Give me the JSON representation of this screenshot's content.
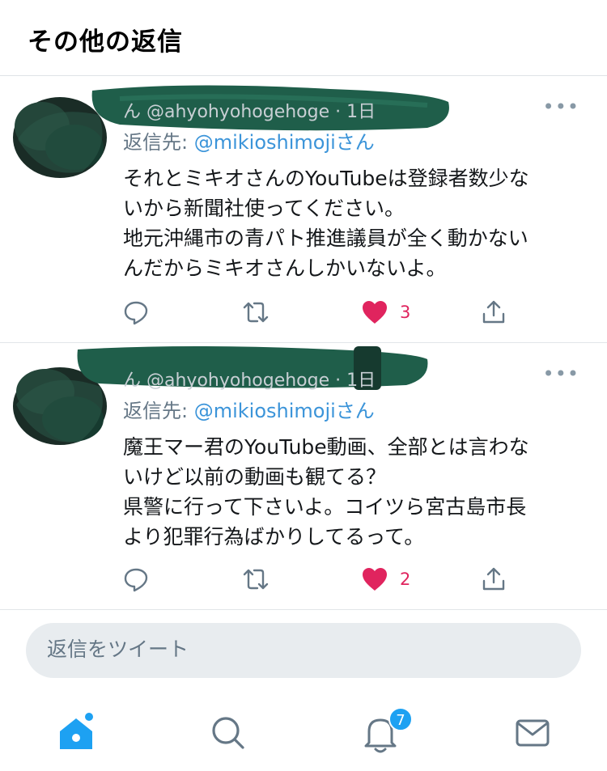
{
  "header": {
    "title": "その他の返信"
  },
  "tweets": [
    {
      "handle_line": "ん @ahyohyohogehoge · 1日",
      "reply_prefix": "返信先: ",
      "reply_mention": "@mikioshimoji",
      "reply_suffix": "さん",
      "body": [
        "それとミキオさんのYouTubeは登録者数少な",
        "いから新聞社使ってください。",
        "地元沖縄市の青パト推進議員が全く動かない",
        "んだからミキオさんしかいないよ。"
      ],
      "like_count": "3",
      "liked": true
    },
    {
      "handle_line": "ん @ahyohyohogehoge · 1日",
      "reply_prefix": "返信先: ",
      "reply_mention": "@mikioshimoji",
      "reply_suffix": "さん",
      "body": [
        "魔王マー君のYouTube動画、全部とは言わな",
        "いけど以前の動画も観てる？",
        "県警に行って下さいよ。コイツら宮古島市長",
        "より犯罪行為ばかりしてるって。"
      ],
      "like_count": "2",
      "liked": true
    }
  ],
  "reply_input": {
    "placeholder": "返信をツイート"
  },
  "tabbar": {
    "items": [
      "home-icon",
      "search-icon",
      "notifications-icon",
      "messages-icon"
    ],
    "notification_badge": "7"
  },
  "colors": {
    "accent": "#1da1f2",
    "like": "#e0245e",
    "mention": "#3b94d9",
    "redaction": "#1f5e4a"
  }
}
